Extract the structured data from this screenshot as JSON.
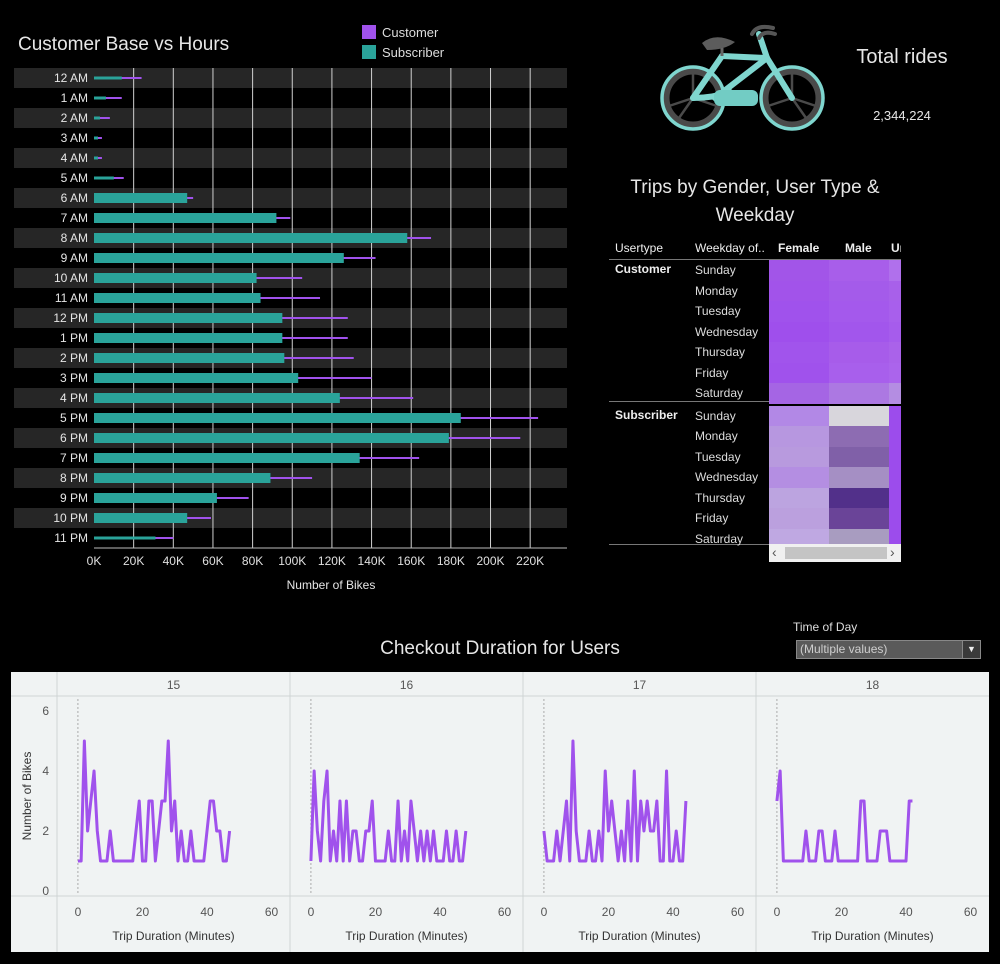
{
  "colors": {
    "customer": "#a052ec",
    "subscriber": "#2aa39a",
    "text": "#e6e6e6"
  },
  "hours_panel": {
    "title": "Customer Base vs Hours",
    "legend": [
      {
        "label": "Customer",
        "color": "#a052ec"
      },
      {
        "label": "Subscriber",
        "color": "#2aa39a"
      }
    ]
  },
  "total": {
    "label": "Total rides",
    "value": "2,344,224",
    "icon": "bicycle-icon"
  },
  "heatmap": {
    "title": "Trips by Gender, User Type & Weekday",
    "headers": {
      "usertype": "Usertype",
      "weekday": "Weekday of..",
      "female": "Female",
      "male": "Male",
      "unknown": "Ur"
    },
    "scroll_left": "‹",
    "scroll_right": "›"
  },
  "duration_panel": {
    "title": "Checkout Duration for Users",
    "filter_label": "Time of Day",
    "filter_value": "(Multiple values)"
  },
  "chart_data": [
    {
      "type": "bar",
      "title": "Customer Base vs Hours",
      "orientation": "horizontal",
      "xlabel": "Number of Bikes",
      "ylabel": "",
      "xlim": [
        0,
        230000
      ],
      "xticks": [
        0,
        20000,
        40000,
        60000,
        80000,
        100000,
        120000,
        140000,
        160000,
        180000,
        200000,
        220000
      ],
      "xtick_labels": [
        "0K",
        "20K",
        "40K",
        "60K",
        "80K",
        "100K",
        "120K",
        "140K",
        "160K",
        "180K",
        "200K",
        "220K"
      ],
      "categories": [
        "12 AM",
        "1 AM",
        "2 AM",
        "3 AM",
        "4 AM",
        "5 AM",
        "6 AM",
        "7 AM",
        "8 AM",
        "9 AM",
        "10 AM",
        "11 AM",
        "12 PM",
        "1 PM",
        "2 PM",
        "3 PM",
        "4 PM",
        "5 PM",
        "6 PM",
        "7 PM",
        "8 PM",
        "9 PM",
        "10 PM",
        "11 PM"
      ],
      "series": [
        {
          "name": "Subscriber",
          "color": "#2aa39a",
          "values": [
            14000,
            6000,
            3000,
            2000,
            2000,
            10000,
            47000,
            92000,
            158000,
            126000,
            82000,
            84000,
            95000,
            95000,
            96000,
            103000,
            124000,
            185000,
            179000,
            134000,
            89000,
            62000,
            47000,
            31000
          ]
        },
        {
          "name": "Customer",
          "color": "#a052ec",
          "values": [
            24000,
            14000,
            8000,
            4000,
            4000,
            15000,
            50000,
            99000,
            170000,
            142000,
            105000,
            114000,
            128000,
            128000,
            131000,
            140000,
            161000,
            224000,
            215000,
            164000,
            110000,
            78000,
            59000,
            40000
          ]
        }
      ],
      "grid": true
    },
    {
      "type": "heatmap",
      "title": "Trips by Gender, User Type & Weekday",
      "columns": [
        "Female",
        "Male",
        "Ur"
      ],
      "groups": [
        {
          "usertype": "Customer",
          "rows": [
            {
              "weekday": "Sunday",
              "colors": [
                "#a255e8",
                "#a85eea",
                "#b070ec"
              ]
            },
            {
              "weekday": "Monday",
              "colors": [
                "#a253ea",
                "#a45bea",
                "#a860ea"
              ]
            },
            {
              "weekday": "Tuesday",
              "colors": [
                "#a052ec",
                "#a459ec",
                "#a85fec"
              ]
            },
            {
              "weekday": "Wednesday",
              "colors": [
                "#9f4fec",
                "#a256ec",
                "#a65cec"
              ]
            },
            {
              "weekday": "Thursday",
              "colors": [
                "#a154ec",
                "#a75cea",
                "#aa62ea"
              ]
            },
            {
              "weekday": "Friday",
              "colors": [
                "#a052ec",
                "#a85fec",
                "#ab64ec"
              ]
            },
            {
              "weekday": "Saturday",
              "colors": [
                "#a565e4",
                "#ac78e2",
                "#b48de2"
              ]
            }
          ]
        },
        {
          "usertype": "Subscriber",
          "rows": [
            {
              "weekday": "Sunday",
              "colors": [
                "#b288e6",
                "#d8d6dc",
                "#9c4cec"
              ]
            },
            {
              "weekday": "Monday",
              "colors": [
                "#b797e0",
                "#8d6cb2",
                "#9c4cec"
              ]
            },
            {
              "weekday": "Tuesday",
              "colors": [
                "#b89ade",
                "#8060a8",
                "#9c4cec"
              ]
            },
            {
              "weekday": "Wednesday",
              "colors": [
                "#b48ee2",
                "#a58fc4",
                "#9c4cec"
              ]
            },
            {
              "weekday": "Thursday",
              "colors": [
                "#bca4e0",
                "#52308a",
                "#9c4cec"
              ]
            },
            {
              "weekday": "Friday",
              "colors": [
                "#bba0de",
                "#6a4498",
                "#9c4cec"
              ]
            },
            {
              "weekday": "Saturday",
              "colors": [
                "#bfa8e2",
                "#a89cc0",
                "#9c4cec"
              ]
            }
          ]
        }
      ]
    },
    {
      "type": "line",
      "title": "Checkout Duration for Users",
      "facet_label": "Time of Day",
      "xlabel": "Trip Duration (Minutes)",
      "ylabel": "Number of Bikes",
      "xlim": [
        -4,
        62
      ],
      "ylim": [
        0,
        6.3
      ],
      "xticks": [
        0,
        20,
        40,
        60
      ],
      "yticks": [
        0,
        2,
        4,
        6
      ],
      "color": "#a052ec",
      "facets": [
        {
          "name": "15",
          "x": [
            0,
            1,
            2,
            3,
            4,
            5,
            6,
            7,
            8,
            9,
            10,
            11,
            12,
            13,
            14,
            15,
            16,
            17,
            18,
            19,
            20,
            21,
            22,
            23,
            24,
            25,
            26,
            27,
            28,
            29,
            30,
            31,
            32,
            33,
            34,
            35,
            36,
            37,
            38,
            39,
            40,
            41,
            42,
            43,
            44,
            45,
            46,
            47,
            48,
            49,
            50,
            51,
            52,
            53,
            54,
            55,
            56,
            57,
            58,
            59
          ],
          "y": [
            1,
            1,
            5,
            2,
            3,
            4,
            2,
            1,
            1,
            1,
            2,
            1,
            1,
            1,
            1,
            1,
            1,
            1,
            2,
            3,
            1,
            1,
            3,
            3,
            1,
            2,
            3,
            3,
            5,
            2,
            3,
            1,
            2,
            1,
            1,
            2,
            1,
            1,
            1,
            1,
            2,
            3,
            3,
            2,
            2,
            1,
            1,
            2
          ]
        },
        {
          "name": "16",
          "x": [
            0,
            1,
            2,
            3,
            4,
            5,
            6,
            7,
            8,
            9,
            10,
            11,
            12,
            13,
            14,
            15,
            16,
            17,
            18,
            19,
            20,
            21,
            22,
            23,
            24,
            25,
            26,
            27,
            28,
            29,
            30,
            31,
            32,
            33,
            34,
            35,
            36,
            37,
            38,
            39,
            40,
            41,
            42,
            43,
            44,
            45,
            46,
            47,
            48,
            49,
            50,
            51,
            52,
            53,
            54,
            55,
            56,
            57,
            58,
            59
          ],
          "y": [
            1,
            4,
            2,
            1,
            3,
            4,
            1,
            2,
            1,
            3,
            1,
            3,
            1,
            2,
            2,
            1,
            1,
            2,
            2,
            3,
            1,
            1,
            1,
            1,
            2,
            1,
            1,
            3,
            1,
            2,
            1,
            3,
            2,
            1,
            2,
            1,
            2,
            1,
            2,
            1,
            1,
            1,
            2,
            1,
            1,
            2,
            1,
            1,
            2
          ]
        },
        {
          "name": "17",
          "x": [
            0,
            1,
            2,
            3,
            4,
            5,
            6,
            7,
            8,
            9,
            10,
            11,
            12,
            13,
            14,
            15,
            16,
            17,
            18,
            19,
            20,
            21,
            22,
            23,
            24,
            25,
            26,
            27,
            28,
            29,
            30,
            31,
            32,
            33,
            34,
            35,
            36,
            37,
            38,
            39,
            40,
            41,
            42,
            43,
            44,
            45,
            46,
            47,
            48,
            49,
            50,
            51,
            52,
            53,
            54,
            55,
            56,
            57,
            58,
            59
          ],
          "y": [
            2,
            1,
            1,
            1,
            2,
            1,
            2,
            3,
            1,
            5,
            2,
            1,
            1,
            1,
            2,
            1,
            1,
            2,
            1,
            4,
            2,
            3,
            2,
            1,
            2,
            1,
            3,
            1,
            4,
            1,
            3,
            2,
            3,
            2,
            2,
            3,
            1,
            1,
            4,
            1,
            1,
            2,
            1,
            1,
            3
          ]
        },
        {
          "name": "18",
          "x": [
            0,
            1,
            2,
            3,
            4,
            5,
            6,
            7,
            8,
            9,
            10,
            11,
            12,
            13,
            14,
            15,
            16,
            17,
            18,
            19,
            20,
            21,
            22,
            23,
            24,
            25,
            26,
            27,
            28,
            29,
            30,
            31,
            32,
            33,
            34,
            35,
            36,
            37,
            38,
            39,
            40,
            41,
            42,
            43,
            44,
            45,
            46,
            47,
            48,
            49,
            50,
            51,
            52,
            53,
            54,
            55,
            56,
            57,
            58,
            59
          ],
          "y": [
            3,
            4,
            1,
            1,
            1,
            1,
            1,
            1,
            1,
            2,
            1,
            1,
            1,
            2,
            2,
            1,
            1,
            1,
            2,
            1,
            1,
            1,
            1,
            1,
            1,
            1,
            3,
            3,
            1,
            1,
            1,
            1,
            2,
            2,
            2,
            1,
            1,
            1,
            1,
            1,
            1,
            3,
            3
          ]
        }
      ]
    }
  ]
}
